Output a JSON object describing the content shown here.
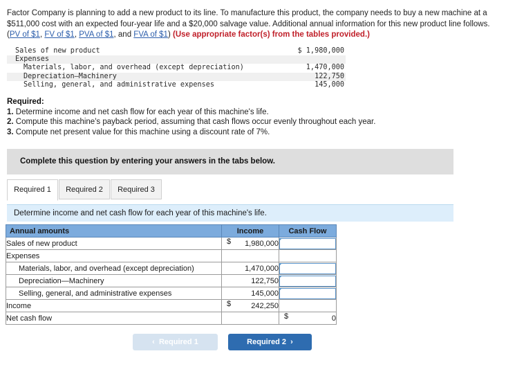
{
  "intro": {
    "part1": "Factor Company is planning to add a new product to its line. To manufacture this product, the company needs to buy a new machine at a $511,000 cost with an expected four-year life and a $20,000 salvage value. Additional annual information for this new product line follows. (",
    "link1": "PV of $1",
    "sep1": ", ",
    "link2": "FV of $1",
    "sep2": ", ",
    "link3": "PVA of $1",
    "sep3": ", and ",
    "link4": "FVA of $1",
    "part2": ") ",
    "bold_note": "(Use appropriate factor(s) from the tables provided.)"
  },
  "mono_block": {
    "rows": [
      {
        "label": "Sales of new product",
        "amount": "$ 1,980,000",
        "indent": false,
        "shaded": false
      },
      {
        "label": "Expenses",
        "amount": "",
        "indent": false,
        "shaded": true
      },
      {
        "label": "Materials, labor, and overhead (except depreciation)",
        "amount": "1,470,000",
        "indent": true,
        "shaded": false
      },
      {
        "label": "Depreciation—Machinery",
        "amount": "122,750",
        "indent": true,
        "shaded": true
      },
      {
        "label": "Selling, general, and administrative expenses",
        "amount": "145,000",
        "indent": true,
        "shaded": false
      }
    ]
  },
  "required": {
    "heading": "Required:",
    "items": [
      {
        "num": "1.",
        "text": " Determine income and net cash flow for each year of this machine's life."
      },
      {
        "num": "2.",
        "text": " Compute this machine's payback period, assuming that cash flows occur evenly throughout each year."
      },
      {
        "num": "3.",
        "text": " Compute net present value for this machine using a discount rate of 7%."
      }
    ]
  },
  "instruction_bar": {
    "text": "Complete this question by entering your answers in the tabs below."
  },
  "tabs": [
    {
      "label": "Required 1",
      "active": true
    },
    {
      "label": "Required 2",
      "active": false
    },
    {
      "label": "Required 3",
      "active": false
    }
  ],
  "info_bar": {
    "text": "Determine income and net cash flow for each year of this machine's life."
  },
  "answer_table": {
    "headers": {
      "label": "Annual amounts",
      "income": "Income",
      "cash_flow": "Cash Flow"
    },
    "rows": [
      {
        "label": "Sales of new product",
        "indent": false,
        "income_dollar": "$",
        "income": "1,980,000",
        "income_topline": false,
        "cash_type": "input",
        "cash_dollar": "",
        "cash": ""
      },
      {
        "label": "Expenses",
        "indent": false,
        "income_dollar": "",
        "income": "",
        "income_topline": false,
        "cash_type": "plain",
        "cash_dollar": "",
        "cash": ""
      },
      {
        "label": "Materials, labor, and overhead (except depreciation)",
        "indent": true,
        "income_dollar": "",
        "income": "1,470,000",
        "income_topline": false,
        "cash_type": "input",
        "cash_dollar": "",
        "cash": ""
      },
      {
        "label": "Depreciation—Machinery",
        "indent": true,
        "income_dollar": "",
        "income": "122,750",
        "income_topline": false,
        "cash_type": "input",
        "cash_dollar": "",
        "cash": ""
      },
      {
        "label": "Selling, general, and administrative expenses",
        "indent": true,
        "income_dollar": "",
        "income": "145,000",
        "income_topline": false,
        "cash_type": "input",
        "cash_dollar": "",
        "cash": ""
      },
      {
        "label": "Income",
        "indent": false,
        "income_dollar": "$",
        "income": "242,250",
        "income_topline": true,
        "cash_type": "plain",
        "cash_dollar": "",
        "cash": ""
      },
      {
        "label": "Net cash flow",
        "indent": false,
        "income_dollar": "",
        "income": "",
        "income_topline": true,
        "cash_type": "total",
        "cash_dollar": "$",
        "cash": "0"
      }
    ]
  },
  "nav": {
    "prev_label": "Required 1",
    "prev_chevron": "‹",
    "next_label": "Required 2",
    "next_chevron": "›"
  }
}
